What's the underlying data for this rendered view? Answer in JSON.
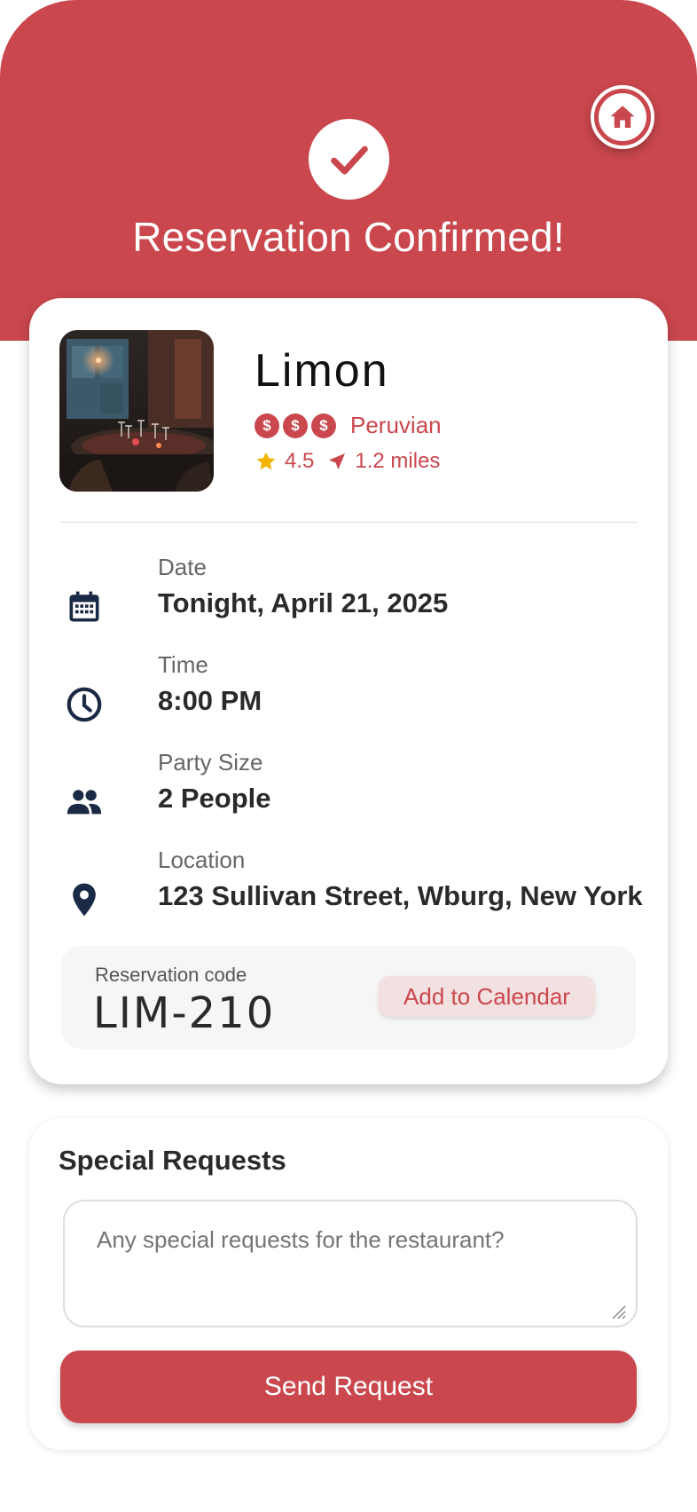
{
  "header": {
    "title": "Reservation Confirmed!",
    "home_icon": "home-icon",
    "check_icon": "check-icon"
  },
  "restaurant": {
    "name": "Limon",
    "price_symbols": [
      "$",
      "$",
      "$"
    ],
    "cuisine": "Peruvian",
    "rating": "4.5",
    "distance": "1.2 miles"
  },
  "details": [
    {
      "icon": "calendar-icon",
      "label": "Date",
      "value": "Tonight, April 21, 2025"
    },
    {
      "icon": "clock-icon",
      "label": "Time",
      "value": "8:00 PM"
    },
    {
      "icon": "people-icon",
      "label": "Party Size",
      "value": "2 People"
    },
    {
      "icon": "location-pin-icon",
      "label": "Location",
      "value": "123 Sullivan Street, Wburg, New York"
    }
  ],
  "reservation": {
    "code_label": "Reservation code",
    "code": "LIM-210",
    "calendar_button": "Add to Calendar"
  },
  "special_requests": {
    "title": "Special Requests",
    "placeholder": "Any special requests for the restaurant?",
    "value": "",
    "send_button": "Send Request"
  },
  "colors": {
    "brand": "#c9474d",
    "icon_dark": "#1b2a44",
    "star": "#f5b400"
  }
}
